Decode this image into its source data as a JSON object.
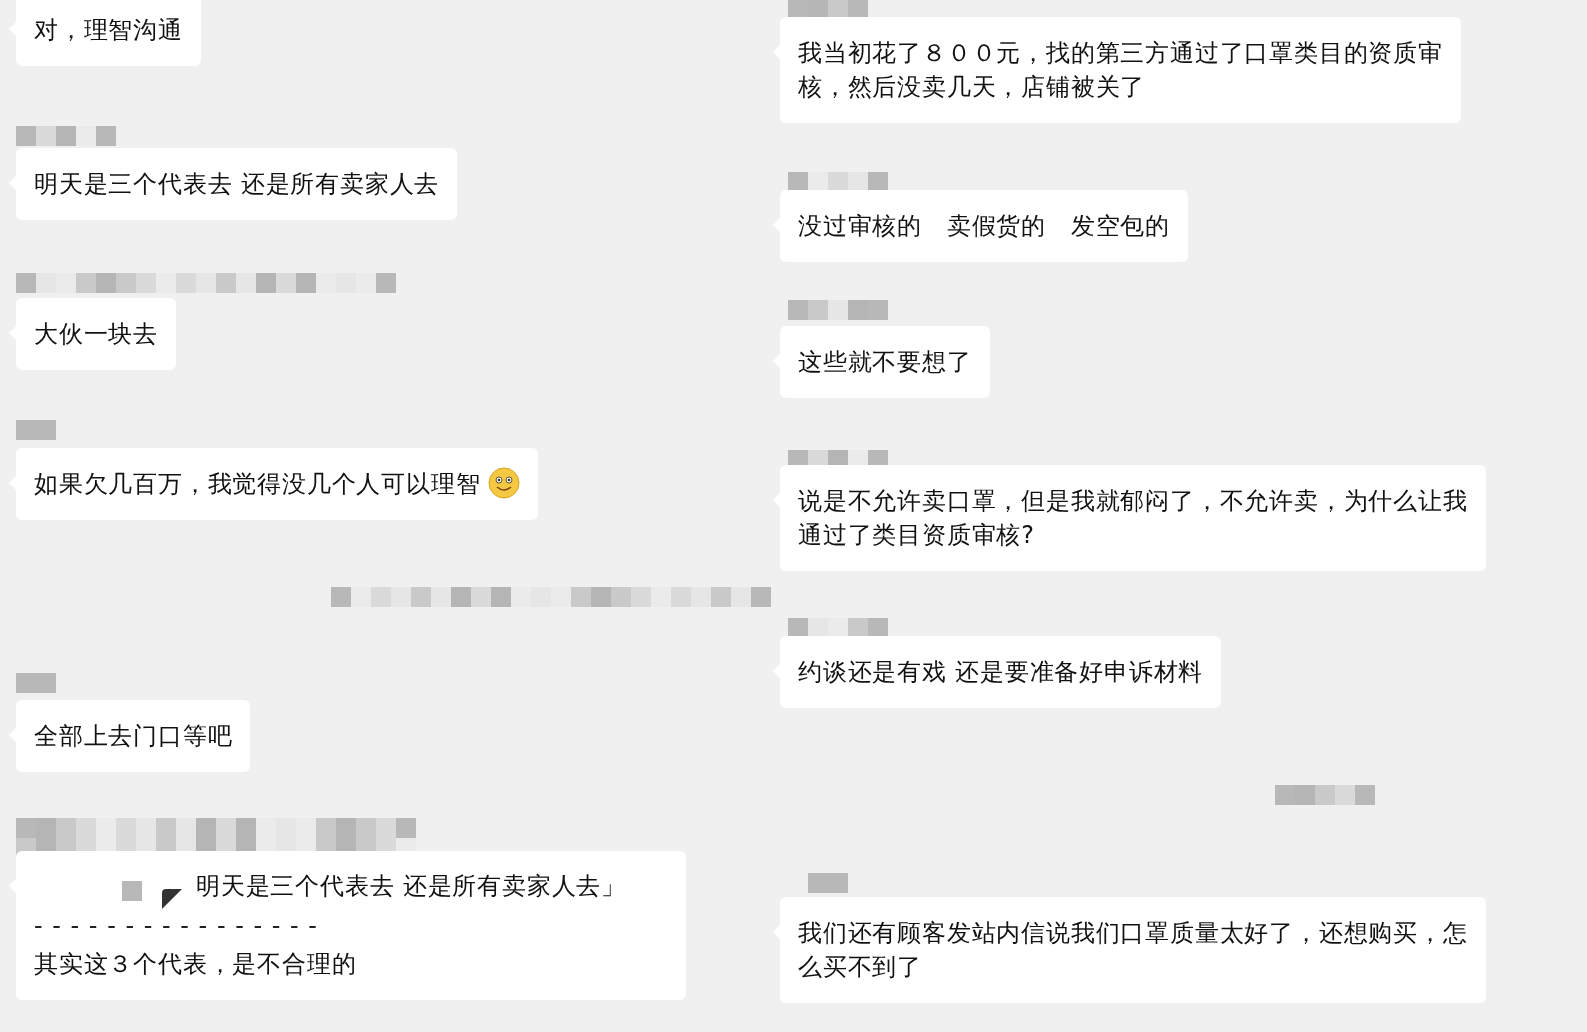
{
  "left": [
    {
      "kind": "message",
      "text": "对，理智沟通"
    },
    {
      "kind": "redacted"
    },
    {
      "kind": "message",
      "text": "明天是三个代表去 还是所有卖家人去"
    },
    {
      "kind": "redacted"
    },
    {
      "kind": "message",
      "text": "大伙一块去"
    },
    {
      "kind": "redacted"
    },
    {
      "kind": "message",
      "text": "如果欠几百万，我觉得没几个人可以理智",
      "trailing_emoji": true
    },
    {
      "kind": "redacted"
    },
    {
      "kind": "redacted"
    },
    {
      "kind": "message",
      "text": "全部上去门口等吧"
    },
    {
      "kind": "redacted"
    },
    {
      "kind": "quote",
      "quote": "明天是三个代表去 还是所有卖家人去」",
      "divider": "- - - - - - - - - - - - - - - -",
      "text": "其实这３个代表，是不合理的"
    }
  ],
  "right": [
    {
      "kind": "redacted"
    },
    {
      "kind": "message",
      "text": "我当初花了８００元，找的第三方通过了口罩类目的资质审核，然后没卖几天，店铺被关了"
    },
    {
      "kind": "redacted"
    },
    {
      "kind": "message",
      "text": "没过审核的　卖假货的　发空包的"
    },
    {
      "kind": "redacted"
    },
    {
      "kind": "message",
      "text": "这些就不要想了"
    },
    {
      "kind": "redacted"
    },
    {
      "kind": "message",
      "text": "说是不允许卖口罩，但是我就郁闷了，不允许卖，为什么让我通过了类目资质审核?"
    },
    {
      "kind": "redacted"
    },
    {
      "kind": "message",
      "text": "约谈还是有戏 还是要准备好申诉材料"
    },
    {
      "kind": "redacted"
    },
    {
      "kind": "redacted"
    },
    {
      "kind": "message",
      "text": "我们还有顾客发站内信说我们口罩质量太好了，还想购买，怎么买不到了"
    }
  ]
}
